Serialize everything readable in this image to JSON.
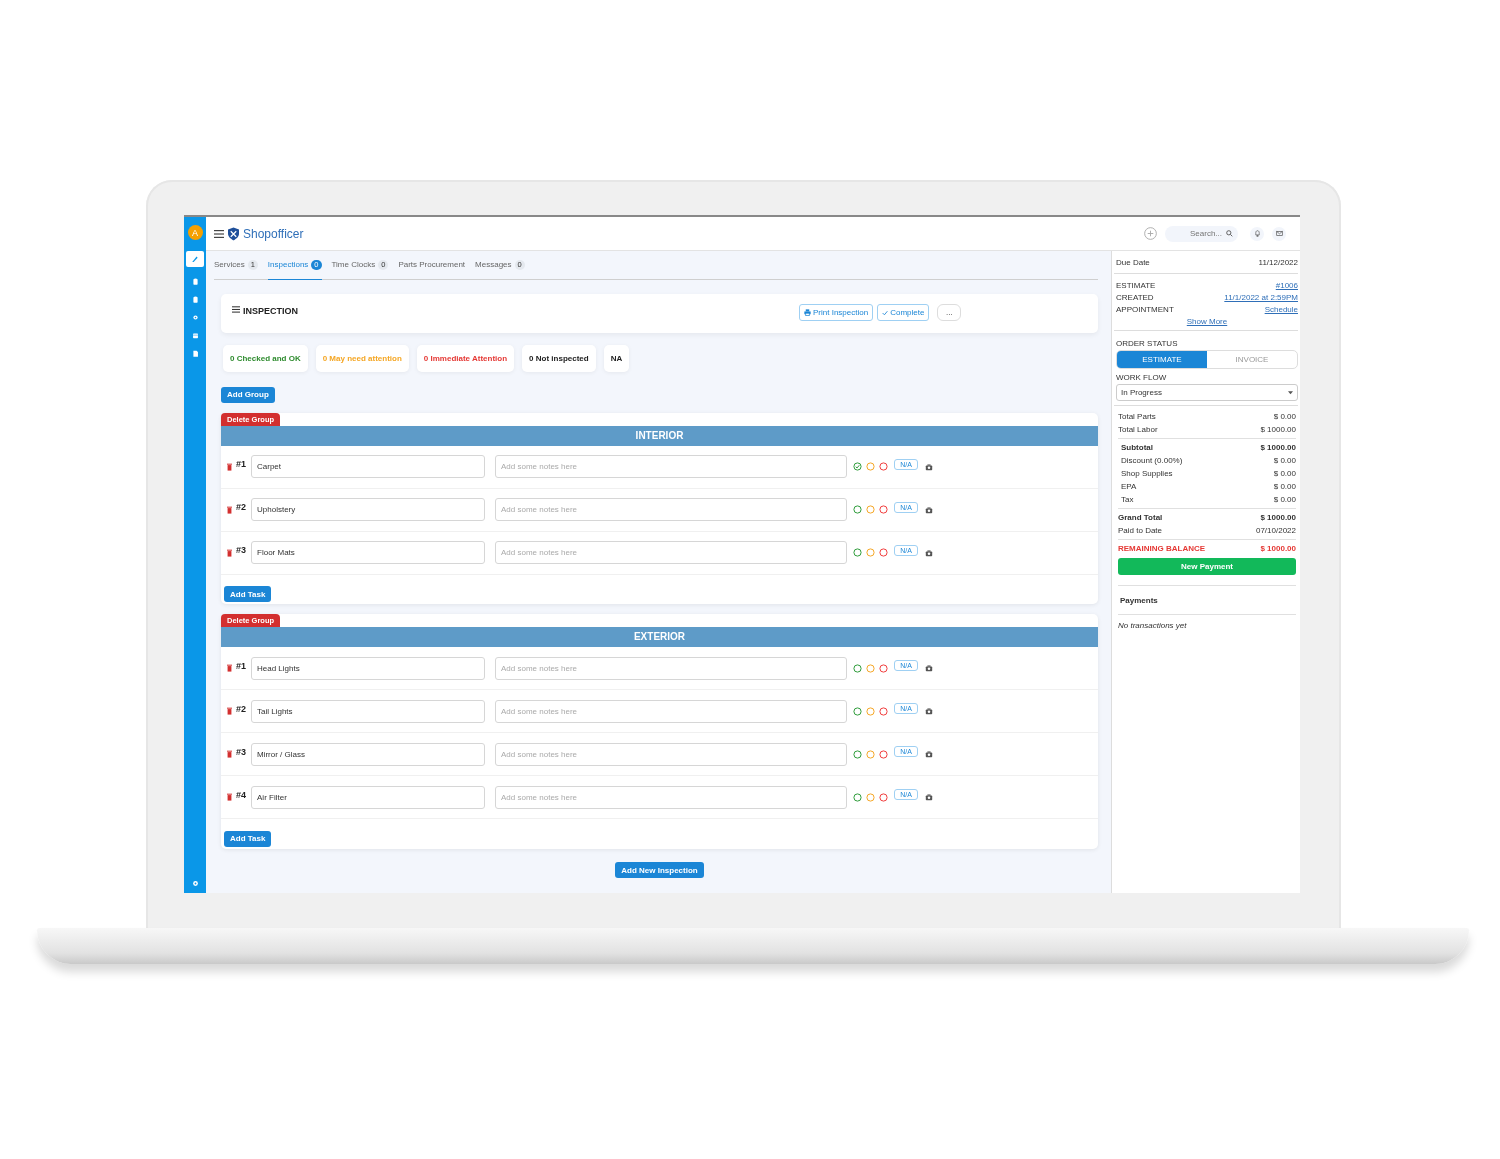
{
  "app": {
    "avatar": "A",
    "brand": "Shopofficer",
    "search": {
      "placeholder": "Search..."
    }
  },
  "tabs": [
    {
      "label": "Services",
      "count": "1",
      "selected": false
    },
    {
      "label": "Inspections",
      "count": "0",
      "selected": true
    },
    {
      "label": "Time Clocks",
      "count": "0",
      "selected": false
    },
    {
      "label": "Parts Procurement",
      "selected": false
    },
    {
      "label": "Messages",
      "count": "0",
      "selected": false
    }
  ],
  "inspection": {
    "title": "INSPECTION",
    "buttons": [
      "Print Inspection",
      "Complete",
      "..."
    ]
  },
  "summary": [
    {
      "label": "0 Checked and OK",
      "color": "#2e8b2e"
    },
    {
      "label": "0 May need attention",
      "color": "#f5a623"
    },
    {
      "label": "0 Immediate Attention",
      "color": "#e53935"
    },
    {
      "label": "0 Not inspected",
      "color": "#222222"
    },
    {
      "label": "NA",
      "color": "#222222"
    }
  ],
  "add_group": "Add Group",
  "groups": [
    {
      "delete": "Delete Group",
      "title": "INTERIOR",
      "add_task": "Add Task",
      "tasks": [
        {
          "number": "#1",
          "name": "Carpet",
          "notes_placeholder": "Add some notes here",
          "na": "N/A",
          "checks": [
            {
              "kind": "ok",
              "checked": true
            },
            {
              "kind": "attention",
              "checked": false
            },
            {
              "kind": "urgent",
              "checked": false
            }
          ]
        },
        {
          "number": "#2",
          "name": "Upholstery",
          "notes_placeholder": "Add some notes here",
          "na": "N/A",
          "checks": [
            {
              "kind": "ok",
              "checked": false
            },
            {
              "kind": "attention",
              "checked": false
            },
            {
              "kind": "urgent",
              "checked": false
            }
          ]
        },
        {
          "number": "#3",
          "name": "Floor Mats",
          "notes_placeholder": "Add some notes here",
          "na": "N/A",
          "checks": [
            {
              "kind": "ok",
              "checked": false
            },
            {
              "kind": "attention",
              "checked": false
            },
            {
              "kind": "urgent",
              "checked": false
            }
          ]
        }
      ]
    },
    {
      "delete": "Delete Group",
      "title": "EXTERIOR",
      "add_task": "Add Task",
      "tasks": [
        {
          "number": "#1",
          "name": "Head Lights",
          "notes_placeholder": "Add some notes here",
          "na": "N/A",
          "checks": [
            {
              "kind": "ok",
              "checked": false
            },
            {
              "kind": "attention",
              "checked": false
            },
            {
              "kind": "urgent",
              "checked": false
            }
          ]
        },
        {
          "number": "#2",
          "name": "Tail Lights",
          "notes_placeholder": "Add some notes here",
          "na": "N/A",
          "checks": [
            {
              "kind": "ok",
              "checked": false
            },
            {
              "kind": "attention",
              "checked": false
            },
            {
              "kind": "urgent",
              "checked": false
            }
          ]
        },
        {
          "number": "#3",
          "name": "Mirror / Glass",
          "notes_placeholder": "Add some notes here",
          "na": "N/A",
          "checks": [
            {
              "kind": "ok",
              "checked": false
            },
            {
              "kind": "attention",
              "checked": false
            },
            {
              "kind": "urgent",
              "checked": false
            }
          ]
        },
        {
          "number": "#4",
          "name": "Air Filter",
          "notes_placeholder": "Add some notes here",
          "na": "N/A",
          "checks": [
            {
              "kind": "ok",
              "checked": false
            },
            {
              "kind": "attention",
              "checked": false
            },
            {
              "kind": "urgent",
              "checked": false
            }
          ]
        }
      ]
    }
  ],
  "add_inspection": "Add New Inspection",
  "panel": {
    "due": {
      "label": "Due Date",
      "value": "11/12/2022"
    },
    "details": [
      {
        "label": "ESTIMATE",
        "value": "#1006"
      },
      {
        "label": "CREATED",
        "value": "11/1/2022 at 2:59PM"
      },
      {
        "label": "APPOINTMENT",
        "value": "Schedule"
      }
    ],
    "show_more": "Show More",
    "order_status": {
      "label": "ORDER STATUS",
      "options": [
        {
          "label": "ESTIMATE",
          "selected": true
        },
        {
          "label": "INVOICE",
          "selected": false
        }
      ]
    },
    "work_flow": {
      "label": "WORK FLOW",
      "value": "In Progress"
    },
    "totals": [
      {
        "kind": "plain",
        "label": "Total Parts",
        "value": "$ 0.00"
      },
      {
        "kind": "plain",
        "label": "Total Labor",
        "value": "$ 1000.00"
      },
      {
        "kind": "rule"
      },
      {
        "kind": "bold-sub",
        "label": "Subtotal",
        "value": "$ 1000.00"
      },
      {
        "kind": "sub",
        "label": "Discount (0.00%)",
        "value": "$ 0.00"
      },
      {
        "kind": "sub",
        "label": "Shop Supplies",
        "value": "$ 0.00"
      },
      {
        "kind": "sub",
        "label": "EPA",
        "value": "$ 0.00"
      },
      {
        "kind": "sub",
        "label": "Tax",
        "value": "$ 0.00"
      },
      {
        "kind": "rule"
      },
      {
        "kind": "bold",
        "label": "Grand Total",
        "value": "$ 1000.00"
      },
      {
        "kind": "plain",
        "label": "Paid to Date",
        "value": "07/10/2022"
      },
      {
        "kind": "rule"
      },
      {
        "kind": "alert",
        "label": "REMAINING BALANCE",
        "value": "$ 1000.00"
      }
    ],
    "new_payment": "New Payment",
    "payments": {
      "title": "Payments",
      "empty": "No transactions yet"
    }
  }
}
